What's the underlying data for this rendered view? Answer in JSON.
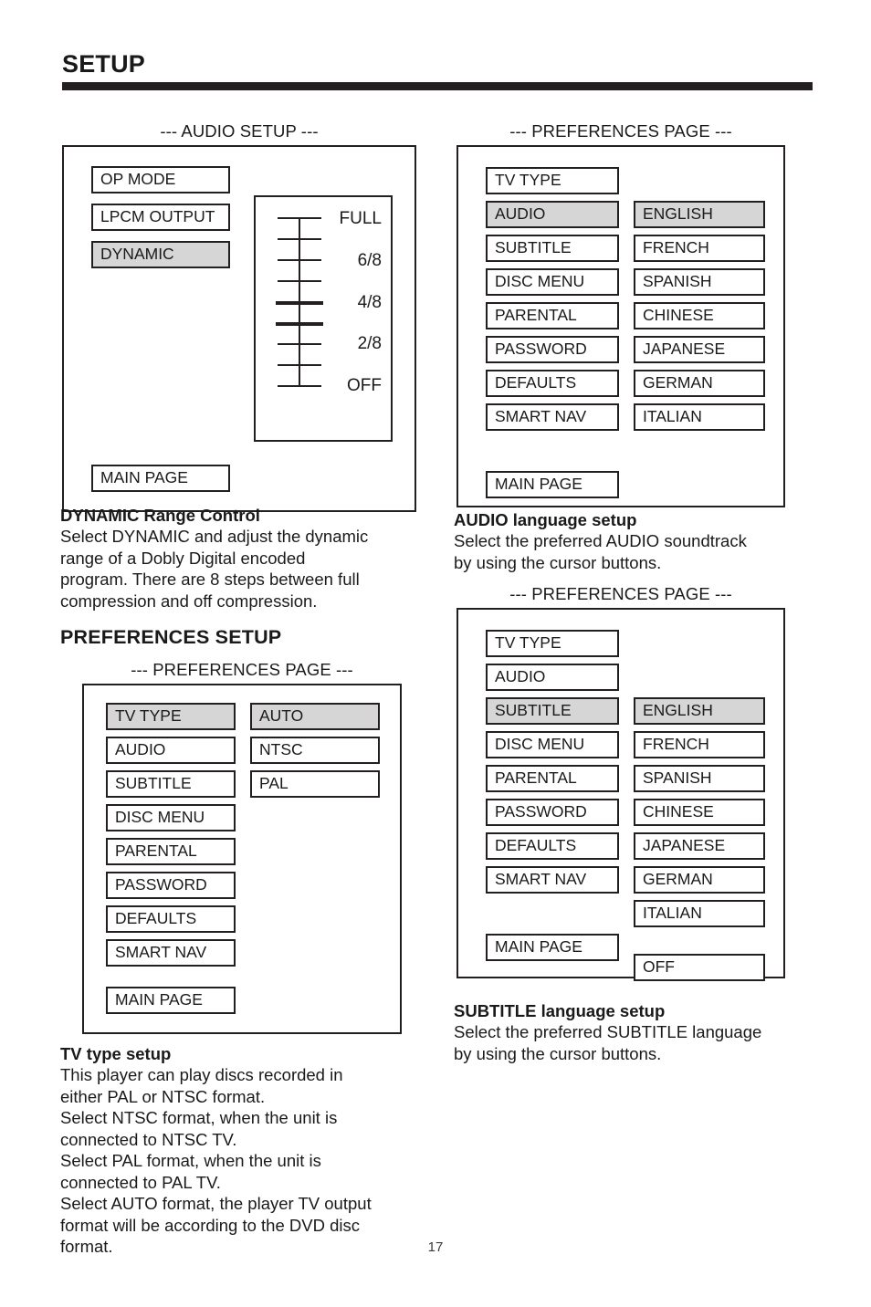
{
  "page": {
    "title": "SETUP",
    "number": "17"
  },
  "audio_setup": {
    "caption": "--- AUDIO SETUP ---",
    "menu": [
      {
        "label": "OP MODE",
        "selected": false
      },
      {
        "label": "LPCM OUTPUT",
        "selected": false
      },
      {
        "label": "DYNAMIC",
        "selected": true
      }
    ],
    "main_page": "MAIN PAGE",
    "slider": {
      "labels": [
        "FULL",
        "6/8",
        "4/8",
        "2/8",
        "OFF"
      ],
      "tick_count": 9,
      "bold_ticks": [
        5,
        6
      ]
    }
  },
  "dynamic_text": {
    "heading": "DYNAMIC Range Control",
    "lines": [
      "Select DYNAMIC and adjust the dynamic",
      "range of a Dobly Digital encoded",
      "program.  There are 8 steps between full",
      "compression and off compression."
    ]
  },
  "audio_lang_text": {
    "heading": "AUDIO language setup",
    "lines": [
      "Select the preferred AUDIO soundtrack",
      "by using the cursor buttons."
    ]
  },
  "preferences_setup_head": "PREFERENCES SETUP",
  "prefs_audio": {
    "caption": "--- PREFERENCES PAGE ---",
    "menu": [
      {
        "label": "TV TYPE",
        "selected": false
      },
      {
        "label": "AUDIO",
        "selected": true
      },
      {
        "label": "SUBTITLE",
        "selected": false
      },
      {
        "label": "DISC MENU",
        "selected": false
      },
      {
        "label": "PARENTAL",
        "selected": false
      },
      {
        "label": "PASSWORD",
        "selected": false
      },
      {
        "label": "DEFAULTS",
        "selected": false
      },
      {
        "label": "SMART NAV",
        "selected": false
      }
    ],
    "main_page": "MAIN PAGE",
    "options": [
      {
        "label": "ENGLISH",
        "selected": true
      },
      {
        "label": "FRENCH",
        "selected": false
      },
      {
        "label": "SPANISH",
        "selected": false
      },
      {
        "label": "CHINESE",
        "selected": false
      },
      {
        "label": "JAPANESE",
        "selected": false
      },
      {
        "label": "GERMAN",
        "selected": false
      },
      {
        "label": "ITALIAN",
        "selected": false
      }
    ]
  },
  "prefs_tvtype": {
    "caption": "--- PREFERENCES PAGE ---",
    "menu": [
      {
        "label": "TV TYPE",
        "selected": true
      },
      {
        "label": "AUDIO",
        "selected": false
      },
      {
        "label": "SUBTITLE",
        "selected": false
      },
      {
        "label": "DISC MENU",
        "selected": false
      },
      {
        "label": "PARENTAL",
        "selected": false
      },
      {
        "label": "PASSWORD",
        "selected": false
      },
      {
        "label": "DEFAULTS",
        "selected": false
      },
      {
        "label": "SMART NAV",
        "selected": false
      }
    ],
    "main_page": "MAIN PAGE",
    "options": [
      {
        "label": "AUTO",
        "selected": true
      },
      {
        "label": "NTSC",
        "selected": false
      },
      {
        "label": "PAL",
        "selected": false
      }
    ]
  },
  "prefs_subtitle": {
    "caption": "--- PREFERENCES PAGE ---",
    "menu": [
      {
        "label": "TV TYPE",
        "selected": false
      },
      {
        "label": "AUDIO",
        "selected": false
      },
      {
        "label": "SUBTITLE",
        "selected": true
      },
      {
        "label": "DISC MENU",
        "selected": false
      },
      {
        "label": "PARENTAL",
        "selected": false
      },
      {
        "label": "PASSWORD",
        "selected": false
      },
      {
        "label": "DEFAULTS",
        "selected": false
      },
      {
        "label": "SMART NAV",
        "selected": false
      }
    ],
    "main_page": "MAIN PAGE",
    "options": [
      {
        "label": "ENGLISH",
        "selected": true
      },
      {
        "label": "FRENCH",
        "selected": false
      },
      {
        "label": "SPANISH",
        "selected": false
      },
      {
        "label": "CHINESE",
        "selected": false
      },
      {
        "label": "JAPANESE",
        "selected": false
      },
      {
        "label": "GERMAN",
        "selected": false
      },
      {
        "label": "ITALIAN",
        "selected": false
      },
      {
        "label": "OFF",
        "selected": false
      }
    ]
  },
  "tv_type_text": {
    "heading": "TV type setup",
    "lines": [
      "This player can play discs recorded in",
      "either PAL or NTSC format.",
      "Select NTSC format, when the unit is",
      "connected to NTSC TV.",
      "Select PAL format, when the unit is",
      "connected to PAL TV.",
      "Select AUTO format, the player TV output",
      "format will be according to the DVD disc",
      "format."
    ]
  },
  "subtitle_text": {
    "heading": "SUBTITLE language setup",
    "lines": [
      "Select the preferred SUBTITLE language",
      "by using the cursor buttons."
    ]
  }
}
